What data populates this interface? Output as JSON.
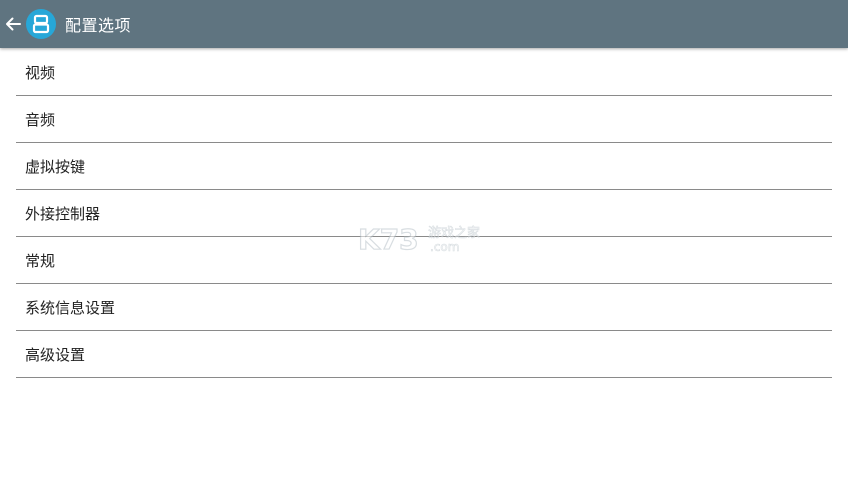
{
  "colors": {
    "app_bar": "#5f7480",
    "app_icon": "#27a7d8",
    "divider": "#8a8a8a"
  },
  "app_bar": {
    "back_icon": "arrow-left-icon",
    "app_icon": "dual-screen-icon",
    "title": "配置选项"
  },
  "menu": {
    "items": [
      {
        "label": "视频"
      },
      {
        "label": "音频"
      },
      {
        "label": "虚拟按键"
      },
      {
        "label": "外接控制器"
      },
      {
        "label": "常规"
      },
      {
        "label": "系统信息设置"
      },
      {
        "label": "高级设置"
      }
    ]
  },
  "watermark": {
    "logo": "K73",
    "site": "游戏之家",
    "domain": ".com"
  }
}
